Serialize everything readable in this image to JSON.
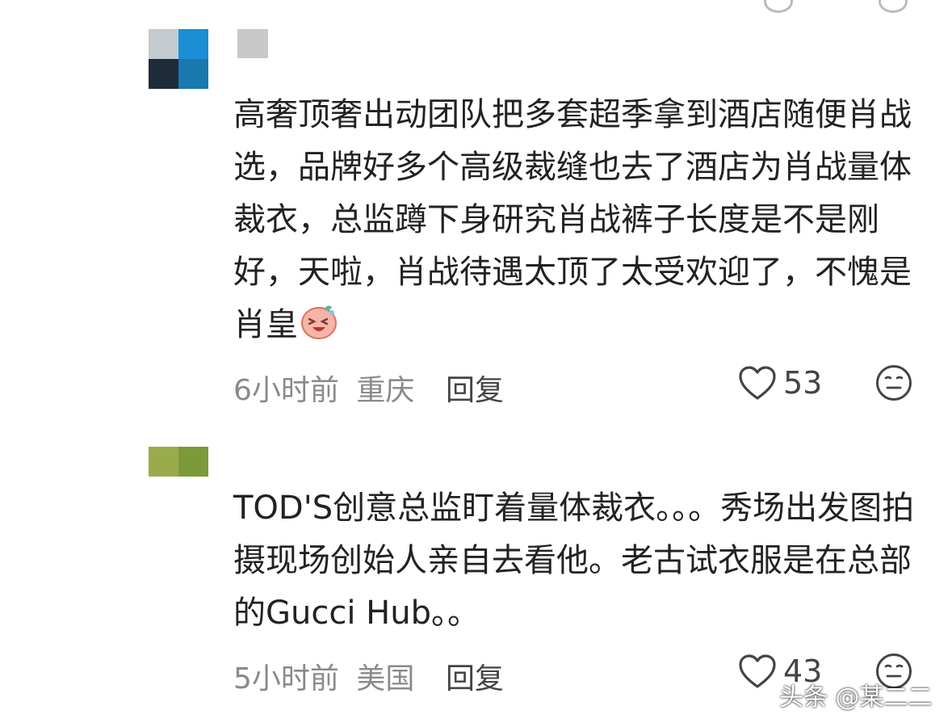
{
  "comments": [
    {
      "text": "高奢顶奢出动团队把多套超季拿到酒店随便肖战选，品牌好多个高级裁缝也去了酒店为肖战量体裁衣，总监蹲下身研究肖战裤子长度是不是刚好，天啦，肖战待遇太顶了太受欢迎了，不愧是肖皇",
      "time": "6小时前",
      "location": "重庆",
      "reply_label": "回复",
      "likes": "53"
    },
    {
      "text": "TOD'S创意总监盯着量体裁衣。。。秀场出发图拍摄现场创始人亲自去看他。老古试衣服是在总部的Gucci Hub。。",
      "time": "5小时前",
      "location": "美国",
      "reply_label": "回复",
      "likes": "43"
    }
  ],
  "watermark": "头条 @某二二",
  "colors": {
    "text": "#222222",
    "meta": "#8a8a8a",
    "icon": "#444444"
  },
  "icons": [
    "heart-outline-icon",
    "meh-face-icon",
    "emoji-sticker"
  ]
}
